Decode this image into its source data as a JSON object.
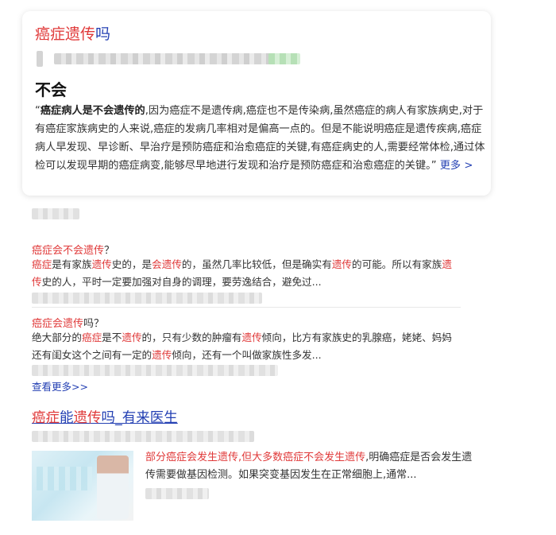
{
  "card": {
    "title_hl": "癌症遗传",
    "title_rest": "吗",
    "answer": "不会",
    "body_open_quote": "“",
    "body_bold": "癌症病人是不会遗传的",
    "body_text": ",因为癌症不是遗传病,癌症也不是传染病,虽然癌症的病人有家族病史,对于有癌症家族病史的人来说,癌症的发病几率相对是偏高一点的。但是不能说明癌症是遗传疾病,癌症病人早发现、早诊断、早治疗是预防癌症和治愈癌症的关键,有癌症病史的人,需要经常体检,通过体检可以发现早期的癌症病变,能够尽早地进行发现和治疗是预防癌症和治愈癌症的关键。”",
    "more": "更多 >"
  },
  "results": [
    {
      "title_hl": "癌症会不会遗传",
      "title_q": "？",
      "body": [
        {
          "t": "癌症",
          "hl": true
        },
        {
          "t": "是有家族"
        },
        {
          "t": "遗传",
          "hl": true
        },
        {
          "t": "史的，是"
        },
        {
          "t": "会遗传",
          "hl": true
        },
        {
          "t": "的，虽然几率比较低，但是确实有"
        },
        {
          "t": "遗传",
          "hl": true
        },
        {
          "t": "的可能。所以有家族"
        },
        {
          "t": "遗传",
          "hl": true
        },
        {
          "t": "史的人，平时一定要加强对自身的调理，要劳逸结合，避免过..."
        }
      ]
    },
    {
      "title_hl": "癌症会遗传",
      "title_q": "吗？",
      "body": [
        {
          "t": "绝大部分的"
        },
        {
          "t": "癌症",
          "hl": true
        },
        {
          "t": "是不"
        },
        {
          "t": "遗传",
          "hl": true
        },
        {
          "t": "的，只有少数的肿瘤有"
        },
        {
          "t": "遗传",
          "hl": true
        },
        {
          "t": "倾向，比方有家族史的乳腺癌，姥姥、妈"
        },
        {
          "t": "妈还有闺女这个之间有一定的"
        },
        {
          "t": "遗传",
          "hl": true
        },
        {
          "t": "倾向，还有一个叫做家族性多发..."
        }
      ]
    }
  ],
  "see_more": "查看更多>>",
  "big": {
    "p1": "癌症",
    "p2": "能",
    "p3": "遗传",
    "p4": "吗_有来医生"
  },
  "big_body_hl": "部分癌症会发生遗传,但大多数癌症不会发生遗传",
  "big_body_rest": ",明确癌症是否会发生遗传需要做基因检测。如果突变基因发生在正常细胞上,通常..."
}
